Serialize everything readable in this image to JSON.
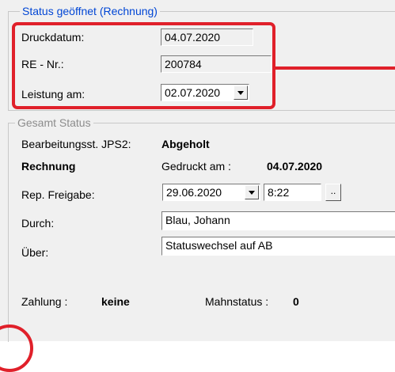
{
  "status_group": {
    "title": "Status geöffnet (Rechnung)",
    "druckdatum_label": "Druckdatum:",
    "druckdatum_value": "04.07.2020",
    "re_nr_label": "RE - Nr.:",
    "re_nr_value": "200784",
    "leistung_label": "Leistung am:",
    "leistung_value": "02.07.2020"
  },
  "gesamt_group": {
    "title": "Gesamt Status",
    "bearbeitung_label": "Bearbeitungsst. JPS2:",
    "bearbeitung_value": "Abgeholt",
    "rechnung_label": "Rechnung",
    "gedruckt_label": "Gedruckt am :",
    "gedruckt_value": "04.07.2020",
    "freigabe_label": "Rep. Freigabe:",
    "freigabe_date": "29.06.2020",
    "freigabe_time": "8:22",
    "ellipsis_label": "..",
    "durch_label": "Durch:",
    "durch_value": "Blau, Johann",
    "ueber_label": "Über:",
    "ueber_value": "Statuswechsel auf AB",
    "zahlung_label": "Zahlung :",
    "zahlung_value": "keine",
    "mahnstatus_label": "Mahnstatus :",
    "mahnstatus_value": "0"
  },
  "icons": {
    "dropdown": "chevron-down-icon"
  },
  "colors": {
    "highlight": "#e0202a",
    "title_blue": "#0046d5",
    "panel": "#f0f0f0"
  }
}
